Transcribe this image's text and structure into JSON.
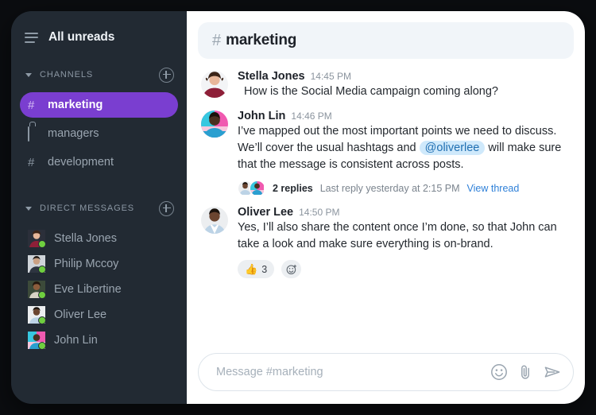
{
  "theme": {
    "frame_bg": "#1b2129",
    "sidebar_bg": "#222a33",
    "accent_purple": "#7a3ed0",
    "link_blue": "#2f80d8",
    "mention_bg": "#cfe9fb",
    "mention_text": "#1f6fb2",
    "online_green": "#6fcf3f",
    "header_bg": "#f1f5f9",
    "panel_bg": "#ffffff"
  },
  "sidebar": {
    "menu_icon": "hamburger-icon",
    "all_unreads_label": "All unreads",
    "channels_section": {
      "title": "CHANNELS",
      "collapse_icon": "chevron-down-icon",
      "add_icon": "plus-circle-icon",
      "items": [
        {
          "name": "marketing",
          "glyph": "#",
          "icon": "hash-icon",
          "active": true
        },
        {
          "name": "managers",
          "glyph": "lock",
          "icon": "lock-icon",
          "active": false
        },
        {
          "name": "development",
          "glyph": "#",
          "icon": "hash-icon",
          "active": false
        }
      ]
    },
    "dm_section": {
      "title": "DIRECT MESSAGES",
      "collapse_icon": "chevron-down-icon",
      "add_icon": "plus-circle-icon",
      "items": [
        {
          "name": "Stella Jones",
          "status": "online"
        },
        {
          "name": "Philip Mccoy",
          "status": "online"
        },
        {
          "name": "Eve Libertine",
          "status": "online"
        },
        {
          "name": "Oliver Lee",
          "status": "online"
        },
        {
          "name": "John Lin",
          "status": "online"
        }
      ]
    }
  },
  "main": {
    "header": {
      "hash": "#",
      "channel_name": "marketing"
    },
    "messages": [
      {
        "author": "Stella Jones",
        "time": "14:45 PM",
        "text": "How is the Social Media campaign coming along?"
      },
      {
        "author": "John Lin",
        "time": "14:46 PM",
        "text_part1": "I’ve mapped out the most important points we need to discuss. We’ll cover the usual hashtags and",
        "mention": "@oliverlee",
        "text_part2": "will make sure that the message is consistent across posts.",
        "thread": {
          "count_label": "2 replies",
          "last_reply": "Last reply yesterday at 2:15 PM",
          "view_link": "View thread",
          "participants": [
            "Oliver Lee",
            "John Lin"
          ]
        }
      },
      {
        "author": "Oliver Lee",
        "time": "14:50 PM",
        "text": "Yes, I’ll also share the content once I’m done, so that John can take a look and make sure everything is on-brand.",
        "reactions": [
          {
            "emoji": "👍",
            "count": "3"
          }
        ],
        "add_reaction_icon": "add-reaction-icon"
      }
    ],
    "composer": {
      "placeholder": "Message #marketing",
      "value": "",
      "emoji_icon": "emoji-icon",
      "attach_icon": "paperclip-icon",
      "send_icon": "send-icon"
    }
  }
}
